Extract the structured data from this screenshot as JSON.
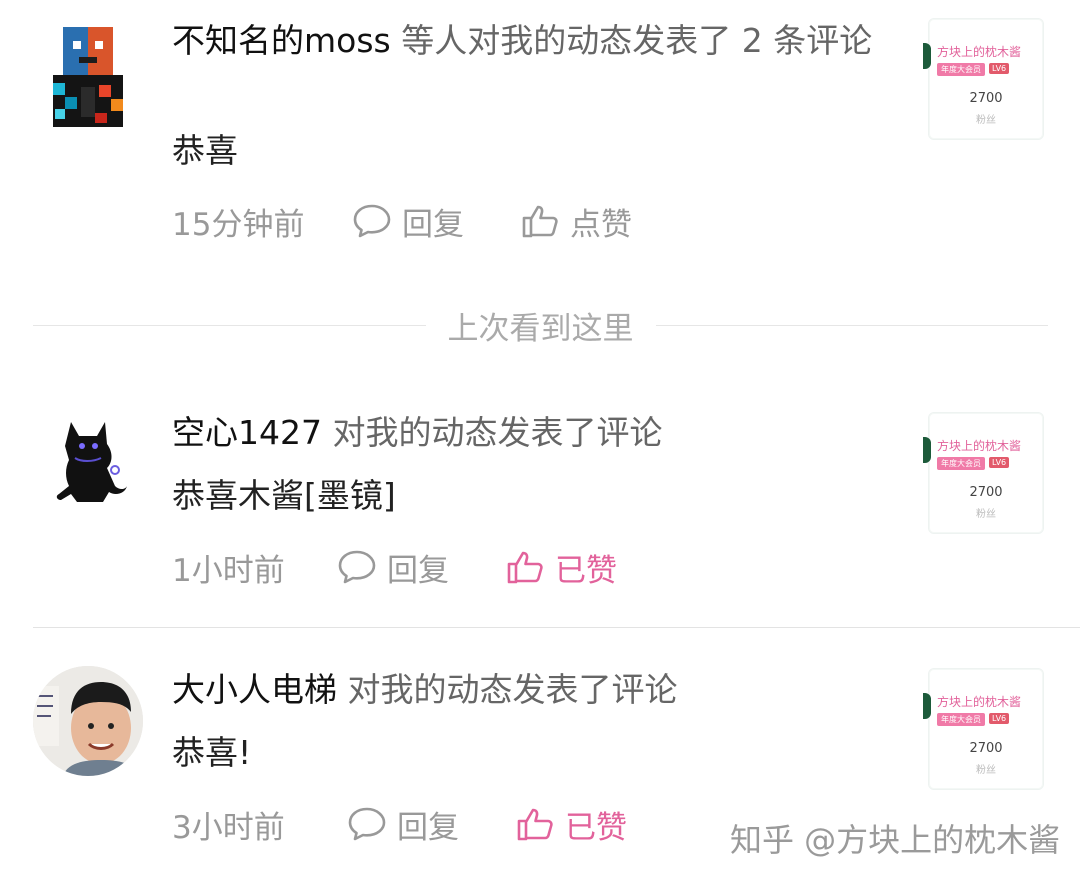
{
  "notifications": [
    {
      "user": "不知名的moss",
      "action": "等人对我的动态发表了 2 条评论",
      "comment": "恭喜",
      "time": "15分钟前",
      "reply_label": "回复",
      "like_label": "点赞",
      "liked": false,
      "avatar": "pixel-art-avatar"
    },
    {
      "user": "空心1427",
      "action": "对我的动态发表了评论",
      "comment": "恭喜木酱[墨镜]",
      "time": "1小时前",
      "reply_label": "回复",
      "like_label": "已赞",
      "liked": true,
      "avatar": "black-cat-avatar"
    },
    {
      "user": "大小人电梯",
      "action": "对我的动态发表了评论",
      "comment": "恭喜!",
      "time": "3小时前",
      "reply_label": "回复",
      "like_label": "已赞",
      "liked": true,
      "avatar": "photo-avatar"
    }
  ],
  "thumbnail": {
    "name": "方块上的枕木酱",
    "badge": "年度大会员",
    "level": "LV6",
    "count": "2700",
    "count_label": "粉丝"
  },
  "divider_label": "上次看到这里",
  "watermark": "知乎 @方块上的枕木酱",
  "colors": {
    "liked": "#e2629b",
    "meta": "#999999",
    "accent_green": "#1c5a3a"
  }
}
